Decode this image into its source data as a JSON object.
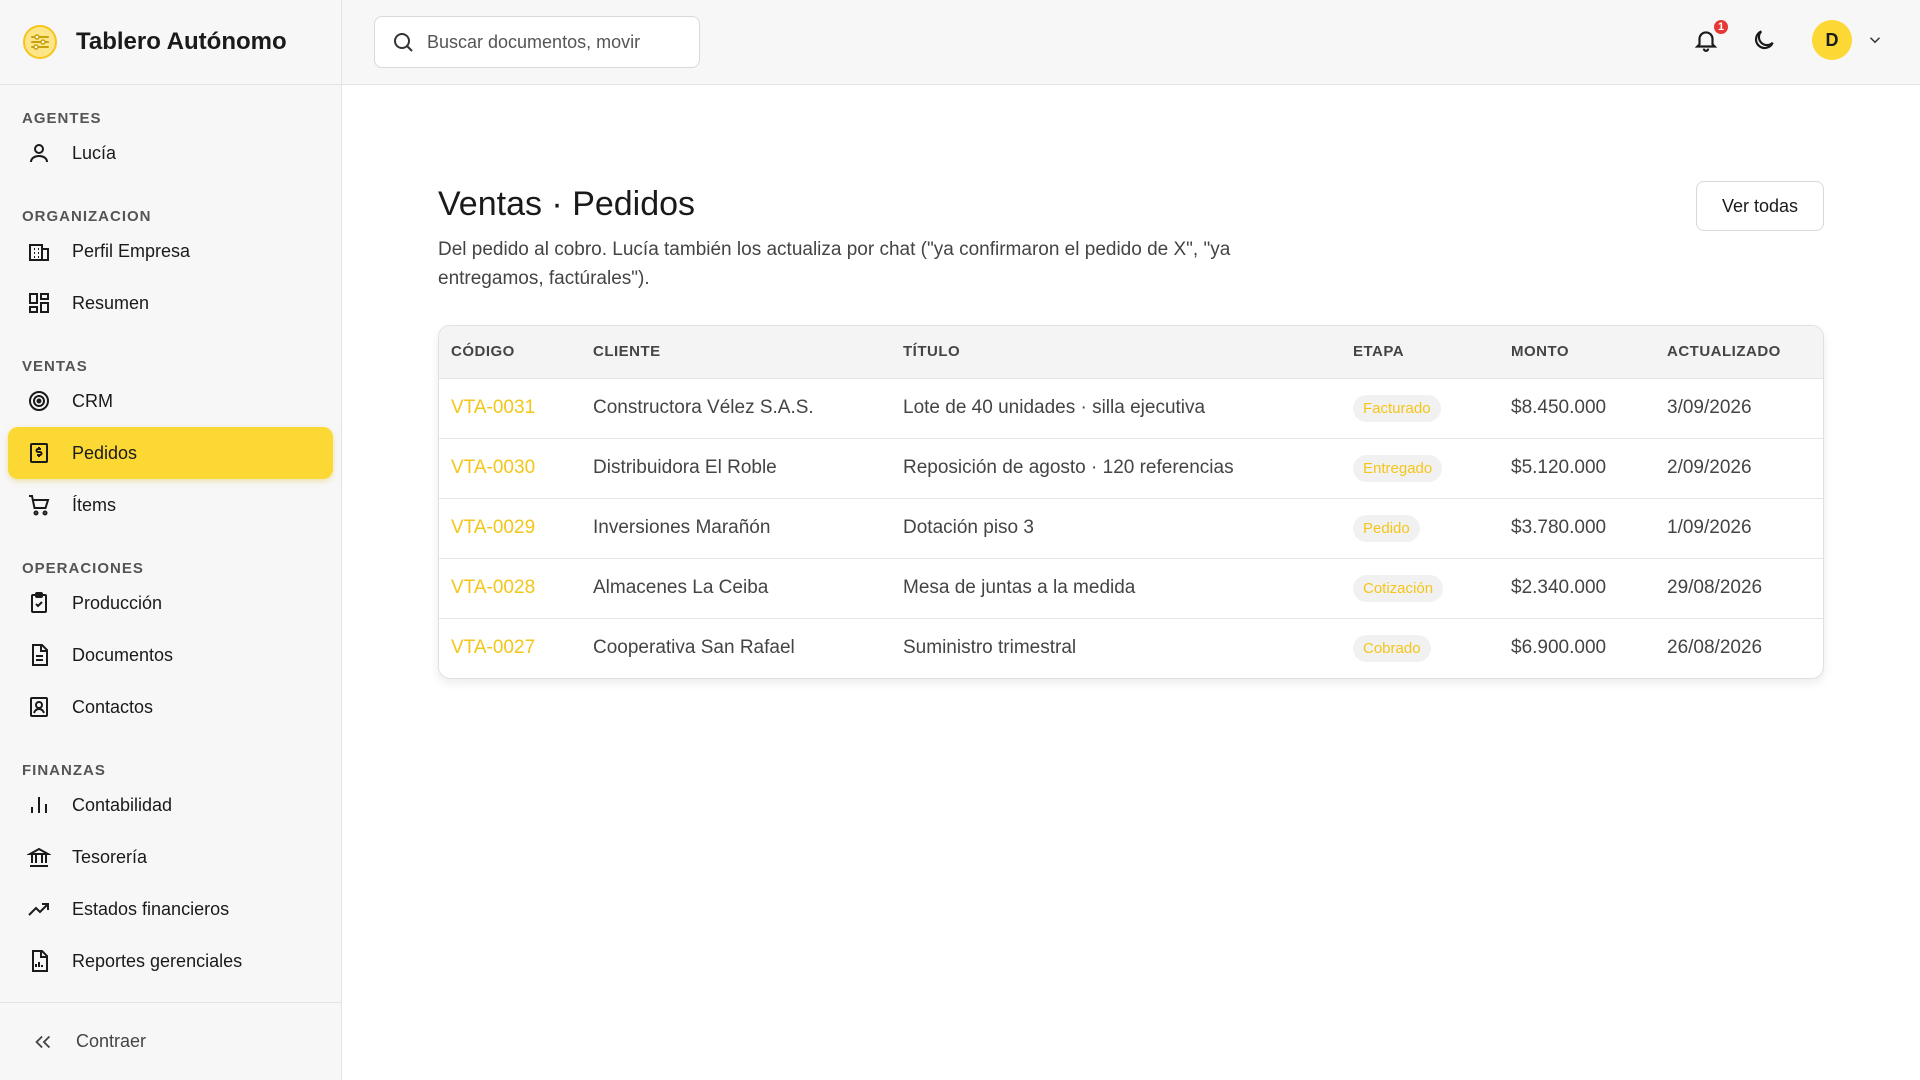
{
  "app": {
    "title": "Tablero Autónomo"
  },
  "sidebar": {
    "sections": [
      {
        "label": "AGENTES",
        "items": [
          {
            "label": "Lucía",
            "icon": "user-icon"
          }
        ]
      },
      {
        "label": "ORGANIZACION",
        "items": [
          {
            "label": "Perfil Empresa",
            "icon": "building-icon"
          },
          {
            "label": "Resumen",
            "icon": "dashboard-icon"
          }
        ]
      },
      {
        "label": "VENTAS",
        "items": [
          {
            "label": "CRM",
            "icon": "target-icon"
          },
          {
            "label": "Pedidos",
            "icon": "invoice-icon",
            "active": true
          },
          {
            "label": "Ítems",
            "icon": "cart-icon"
          }
        ]
      },
      {
        "label": "OPERACIONES",
        "items": [
          {
            "label": "Producción",
            "icon": "clipboard-check-icon"
          },
          {
            "label": "Documentos",
            "icon": "document-icon"
          },
          {
            "label": "Contactos",
            "icon": "contact-icon"
          }
        ]
      },
      {
        "label": "FINANZAS",
        "items": [
          {
            "label": "Contabilidad",
            "icon": "bar-chart-icon"
          },
          {
            "label": "Tesorería",
            "icon": "bank-icon"
          },
          {
            "label": "Estados financieros",
            "icon": "trending-up-icon"
          },
          {
            "label": "Reportes gerenciales",
            "icon": "report-icon"
          }
        ]
      }
    ],
    "collapse_label": "Contraer"
  },
  "topbar": {
    "search_placeholder": "Buscar documentos, movir",
    "notifications_count": "1",
    "avatar_initial": "D"
  },
  "page": {
    "title": "Ventas · Pedidos",
    "description": "Del pedido al cobro. Lucía también los actualiza por chat (\"ya confirmaron el pedido de X\", \"ya entregamos, factúrales\").",
    "view_all_label": "Ver todas"
  },
  "table": {
    "columns": [
      "CÓDIGO",
      "CLIENTE",
      "TÍTULO",
      "ETAPA",
      "MONTO",
      "ACTUALIZADO"
    ],
    "rows": [
      [
        "VTA-0031",
        "Constructora Vélez S.A.S.",
        "Lote de 40 unidades · silla ejecutiva",
        "Facturado",
        "$8.450.000",
        "3/09/2026"
      ],
      [
        "VTA-0030",
        "Distribuidora El Roble",
        "Reposición de agosto · 120 referencias",
        "Entregado",
        "$5.120.000",
        "2/09/2026"
      ],
      [
        "VTA-0029",
        "Inversiones Marañón",
        "Dotación piso 3",
        "Pedido",
        "$3.780.000",
        "1/09/2026"
      ],
      [
        "VTA-0028",
        "Almacenes La Ceiba",
        "Mesa de juntas a la medida",
        "Cotización",
        "$2.340.000",
        "29/08/2026"
      ],
      [
        "VTA-0027",
        "Cooperativa San Rafael",
        "Suministro trimestral",
        "Cobrado",
        "$6.900.000",
        "26/08/2026"
      ]
    ]
  },
  "colors": {
    "accent": "#fcd835",
    "code_link": "#f5c518",
    "badge": "#e53935"
  }
}
